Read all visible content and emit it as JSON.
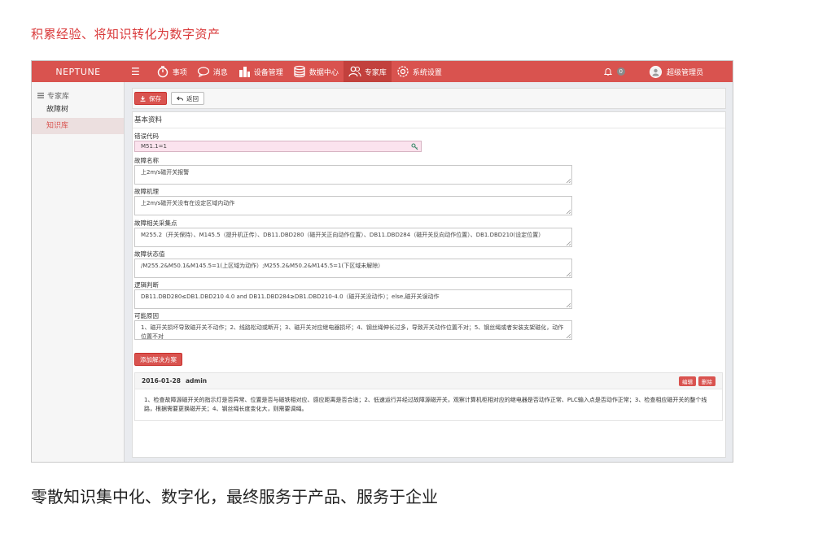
{
  "heading": "积累经验、将知识转化为数字资产",
  "caption": "零散知识集中化、数字化，最终服务于产品、服务于企业",
  "navbar": {
    "brand": "NEPTUNE",
    "items": [
      {
        "label": "事项",
        "icon": "timer-icon"
      },
      {
        "label": "消息",
        "icon": "chat-icon"
      },
      {
        "label": "设备管理",
        "icon": "building-icon"
      },
      {
        "label": "数据中心",
        "icon": "database-icon"
      },
      {
        "label": "专家库",
        "icon": "experts-icon"
      },
      {
        "label": "系统设置",
        "icon": "gear-icon"
      }
    ],
    "notification_count": "0",
    "user": "超级管理员"
  },
  "sidebar": {
    "title": "专家库",
    "items": [
      {
        "label": "故障树"
      },
      {
        "label": "知识库"
      }
    ]
  },
  "toolbar": {
    "save_label": "保存",
    "back_label": "返回"
  },
  "panel": {
    "title": "基本资料",
    "fields": {
      "error_code": {
        "label": "错误代码",
        "value": "M51.1=1"
      },
      "fault_name": {
        "label": "故障名称",
        "value": "上2m/s磁开关报警"
      },
      "fault_mechanism": {
        "label": "故障机理",
        "value": "上2m/s磁开关没有在设定区域内动作"
      },
      "related_points": {
        "label": "故障相关采集点",
        "value": "M255.2（开关保持）、M145.5（提升机正传）、DB11.DBD280（磁开关正向动作位置）、DB11.DBD284（磁开关反向动作位置）、DB1.DBD210(设定位置）"
      },
      "status_value": {
        "label": "故障状态值",
        "value": "/M255.2&M50.1&M145.5=1(上区域为动作）;M255.2&M50.2&M145.5=1(下区域未解除）"
      },
      "logic": {
        "label": "逻辑判断",
        "value": "DB11.DBD280≤DB1.DBD210 4.0 and DB11.DBD284≥DB1.DBD210-4.0（磁开关没动作）；else,磁开关误动作"
      },
      "causes": {
        "label": "可能原因",
        "value": "1、磁开关损坏导致磁开关不动作；2、线路松动或断开；3、磁开关对应继电器损坏；4、钢丝绳伸长过多，导致开关动作位置不对；5、钢丝绳或者安装支架磁化，动作位置不对"
      }
    },
    "add_solution_label": "添加解决方案",
    "solution": {
      "date": "2016-01-28",
      "author": "admin",
      "edit_label": "编辑",
      "delete_label": "删除",
      "text": "1、检查故障源磁开关的指示灯是否异常、位置是否与磁铁相对应、感应距离是否合适；2、低速运行并经过故障源磁开关，观察计算机柜相对应的继电器是否动作正常、PLC输入点是否动作正常；3、检查相应磁开关的整个线路，根据需要更换磁开关；4、钢丝绳长度变化大，则需要调绳。"
    }
  },
  "colors": {
    "brand_red": "#d9534f",
    "heading_red": "#d9393a",
    "pink_input": "#fbe3ee"
  }
}
